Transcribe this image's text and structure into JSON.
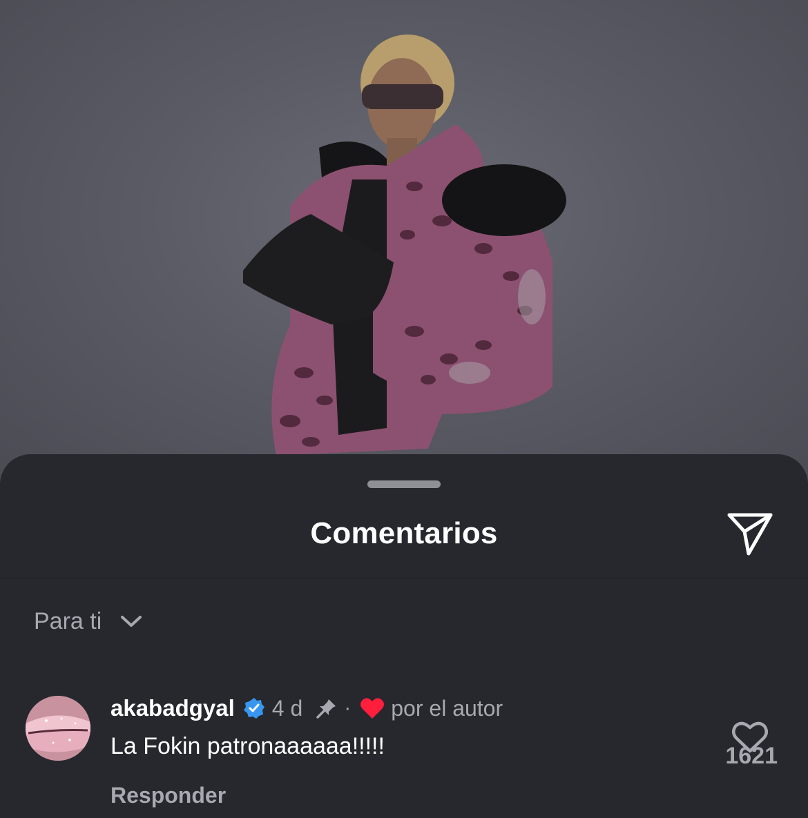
{
  "post": {
    "image_description_icon": "post-photo"
  },
  "sheet": {
    "title": "Comentarios",
    "share_icon": "send-icon",
    "filter_label": "Para ti",
    "filter_icon": "chevron-down-icon"
  },
  "comments": [
    {
      "username": "akabadgyal",
      "verified": true,
      "time": "4 d",
      "pinned": true,
      "separator": "·",
      "liked_by_author_label": "por el autor",
      "text": "La Fokin patronaaaaaa!!!!!",
      "reply_label": "Responder",
      "like_count": "1621"
    }
  ],
  "colors": {
    "sheet_background": "#26282d",
    "primary_text": "#ffffff",
    "secondary_text": "#a6a9b0",
    "verified_blue": "#3797f0",
    "heart_red": "#ff3040"
  }
}
